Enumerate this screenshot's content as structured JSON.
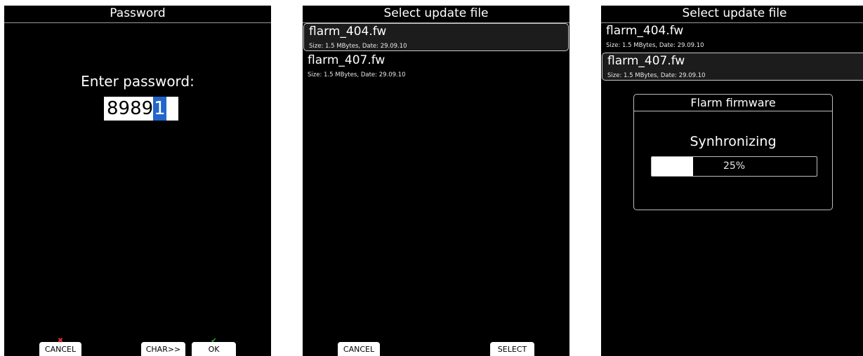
{
  "screen1": {
    "title": "Password",
    "prompt": "Enter password:",
    "password_entered": "8989",
    "password_cursor_char": "1",
    "buttons": {
      "cancel": "CANCEL",
      "char": "CHAR>>",
      "ok": "OK"
    }
  },
  "screen2": {
    "title": "Select update file",
    "files": [
      {
        "name": "flarm_404.fw",
        "meta": "Size: 1.5 MBytes, Date: 29.09.10",
        "selected": true
      },
      {
        "name": "flarm_407.fw",
        "meta": "Size: 1.5 MBytes, Date: 29.09.10",
        "selected": false
      }
    ],
    "buttons": {
      "cancel": "CANCEL",
      "select": "SELECT"
    }
  },
  "screen3": {
    "title": "Select update file",
    "files": [
      {
        "name": "flarm_404.fw",
        "meta": "Size: 1.5 MBytes, Date: 29.09.10",
        "selected": false
      },
      {
        "name": "flarm_407.fw",
        "meta": "Size: 1.5 MBytes, Date: 29.09.10",
        "selected": true
      }
    ],
    "dialog": {
      "title": "Flarm firmware",
      "message": "Synhronizing",
      "progress_percent": 25,
      "progress_label": "25%"
    }
  },
  "icons": {
    "cancel_mark": "x-mark-icon",
    "ok_mark": "check-mark-icon"
  },
  "colors": {
    "screen_bg": "#000000",
    "cursor_highlight": "#2266cc",
    "cancel_mark": "#e03030",
    "ok_mark": "#30b030"
  }
}
